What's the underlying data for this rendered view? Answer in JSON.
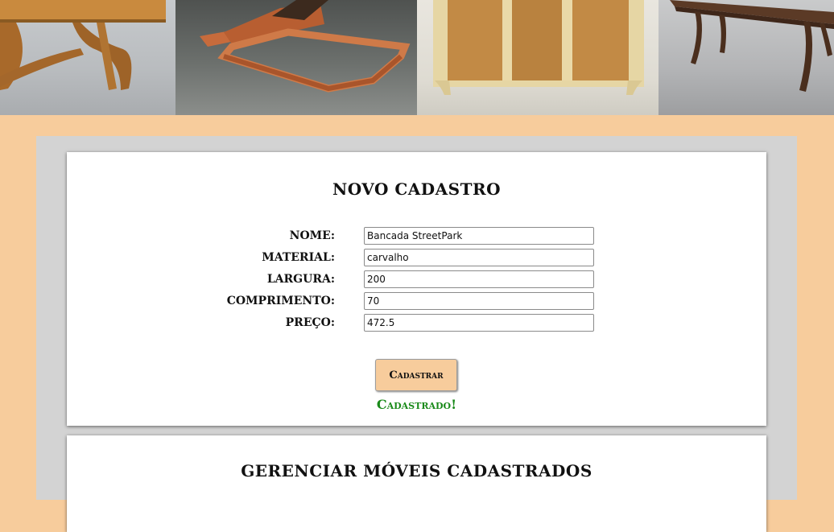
{
  "banner": {
    "images": [
      {
        "name": "table-photo"
      },
      {
        "name": "bed-frame-photo"
      },
      {
        "name": "cabinet-photo"
      },
      {
        "name": "walnut-table-photo"
      }
    ]
  },
  "form": {
    "title": "NOVO CADASTRO",
    "fields": [
      {
        "label": "NOME:",
        "value": "Bancada StreetPark"
      },
      {
        "label": "MATERIAL:",
        "value": "carvalho"
      },
      {
        "label": "LARGURA:",
        "value": "200"
      },
      {
        "label": "COMPRIMENTO:",
        "value": "70"
      },
      {
        "label": "PREÇO:",
        "value": "472.5"
      }
    ],
    "submit_label": "Cadastrar",
    "status_message": "Cadastrado!",
    "status_color": "#1a8a1a",
    "button_color": "#f7cc9c"
  },
  "manage": {
    "title": "GERENCIAR MÓVEIS CADASTRADOS"
  },
  "colors": {
    "page_background": "#f7cc9c",
    "panel_background": "#d3d3d3",
    "card_background": "#ffffff"
  }
}
